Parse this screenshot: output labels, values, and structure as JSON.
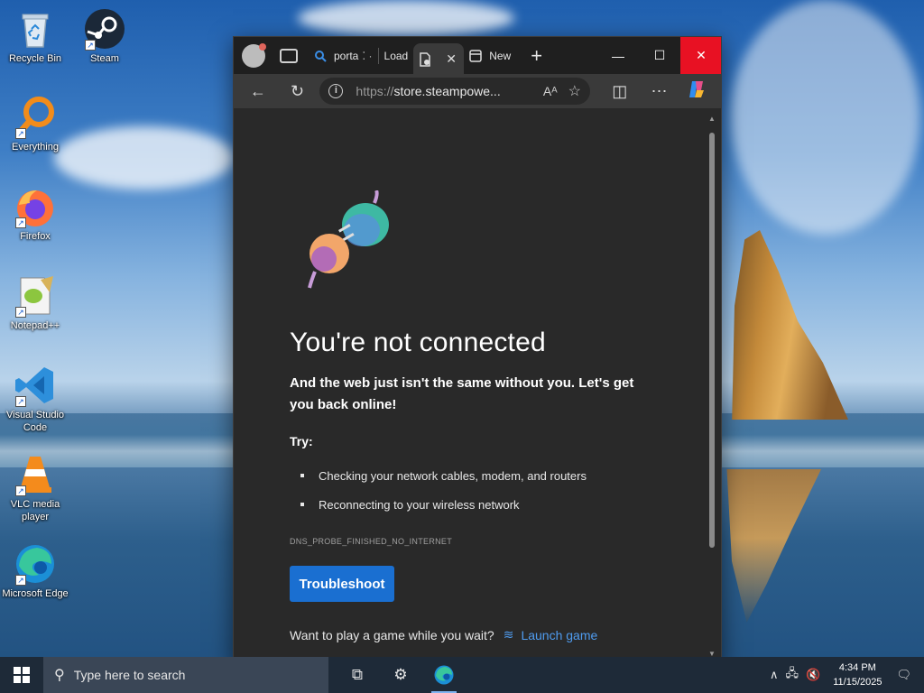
{
  "desktop": {
    "icons": [
      {
        "label": "Recycle Bin",
        "icon": "recycle-bin-icon"
      },
      {
        "label": "Steam",
        "icon": "steam-icon"
      },
      {
        "label": "Everything",
        "icon": "everything-search-icon"
      },
      {
        "label": "Firefox",
        "icon": "firefox-icon"
      },
      {
        "label": "Notepad++",
        "icon": "notepad-plus-plus-icon"
      },
      {
        "label": "Visual Studio Code",
        "icon": "vscode-icon"
      },
      {
        "label": "VLC media player",
        "icon": "vlc-icon"
      },
      {
        "label": "Microsoft Edge",
        "icon": "edge-icon"
      }
    ]
  },
  "browser": {
    "tabs": [
      {
        "label": "porta",
        "icon": "search-icon"
      },
      {
        "label": "Load",
        "icon": "loading-icon"
      },
      {
        "label": "",
        "icon": "error-page-icon",
        "active": true
      },
      {
        "label": "New",
        "icon": "new-tab-icon"
      }
    ],
    "window_controls": {
      "minimize": "—",
      "maximize": "☐",
      "close": "✕"
    },
    "new_tab_glyph": "+",
    "address": {
      "scheme": "https://",
      "host": "store.steampowe...",
      "read_aloud": "Aᴬ"
    },
    "page": {
      "title": "You're not connected",
      "lead": "And the web just isn't the same without you. Let's get you back online!",
      "try_heading": "Try:",
      "suggestions": [
        "Checking your network cables, modem, and routers",
        "Reconnecting to your wireless network"
      ],
      "error_code": "DNS_PROBE_FINISHED_NO_INTERNET",
      "troubleshoot_label": "Troubleshoot",
      "game_prompt": "Want to play a game while you wait?",
      "game_link": "Launch game"
    }
  },
  "taskbar": {
    "search_placeholder": "Type here to search",
    "time": "4:34 PM",
    "date": "11/15/2025"
  },
  "colors": {
    "accent": "#1a6fd1",
    "link": "#4f9cf0",
    "close_button": "#e81123"
  }
}
